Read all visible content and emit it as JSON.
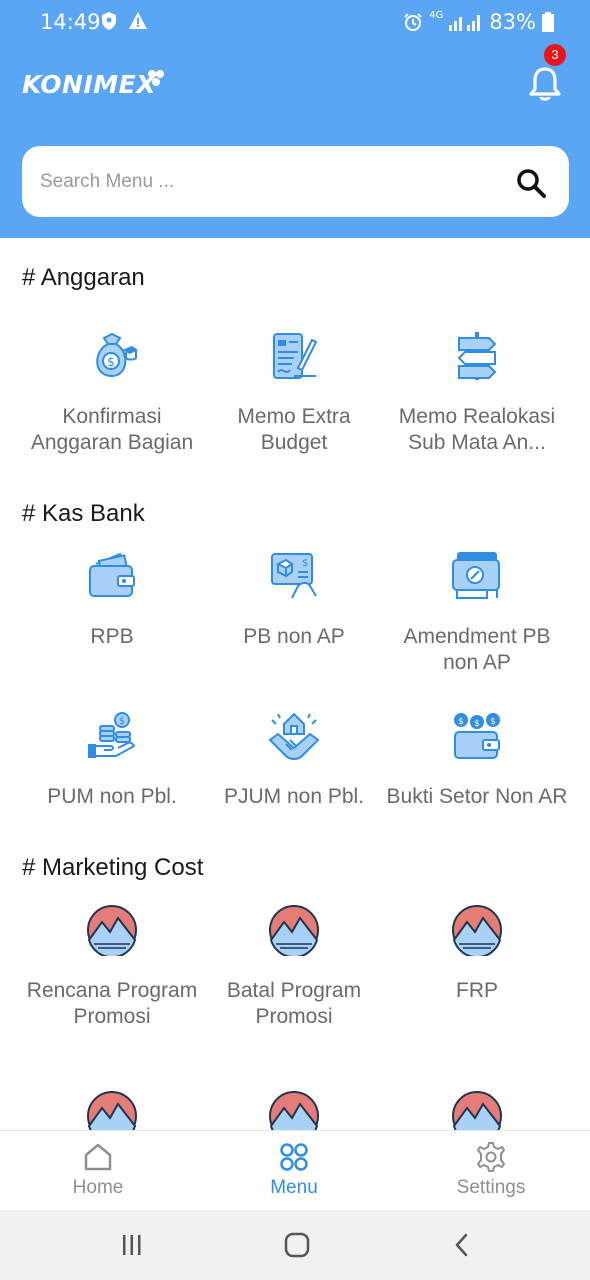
{
  "status": {
    "time": "14:49",
    "battery": "83%",
    "network": "4G"
  },
  "header": {
    "brand": "KONIMEX",
    "notification_count": "3",
    "search_placeholder": "Search Menu ..."
  },
  "sections": [
    {
      "title": "# Anggaran",
      "items": [
        {
          "label": "Konfirmasi Anggaran Bagian",
          "icon": "money-bag-icon"
        },
        {
          "label": "Memo Extra Budget",
          "icon": "memo-sign-icon"
        },
        {
          "label": "Memo Realokasi Sub Mata An...",
          "icon": "signpost-arrows-icon"
        }
      ]
    },
    {
      "title": "# Kas Bank",
      "items": [
        {
          "label": "RPB",
          "icon": "wallet-cash-icon"
        },
        {
          "label": "PB non AP",
          "icon": "invoice-hand-icon"
        },
        {
          "label": "Amendment PB non AP",
          "icon": "payment-card-icon"
        },
        {
          "label": "PUM non Pbl.",
          "icon": "coins-hand-icon"
        },
        {
          "label": "PJUM non Pbl.",
          "icon": "handshake-house-icon"
        },
        {
          "label": "Bukti Setor Non AR",
          "icon": "wallet-coins-icon"
        }
      ]
    },
    {
      "title": "# Marketing Cost",
      "items": [
        {
          "label": "Rencana Program Promosi",
          "icon": "mountain-icon"
        },
        {
          "label": "Batal Program Promosi",
          "icon": "mountain-icon"
        },
        {
          "label": "FRP",
          "icon": "mountain-icon"
        },
        {
          "label": "",
          "icon": "mountain-icon"
        },
        {
          "label": "",
          "icon": "mountain-icon"
        },
        {
          "label": "",
          "icon": "mountain-icon"
        }
      ]
    }
  ],
  "bottom_nav": {
    "items": [
      {
        "label": "Home",
        "icon": "home-icon",
        "active": false
      },
      {
        "label": "Menu",
        "icon": "grid-icon",
        "active": true
      },
      {
        "label": "Settings",
        "icon": "gear-icon",
        "active": false
      }
    ]
  },
  "colors": {
    "header": "#5aa6f5",
    "accent": "#2f8de4",
    "icon_light": "#a9d1f7",
    "badge": "#e8151b",
    "inactive": "#8f8f8f",
    "mountain_sky": "#e47c77"
  }
}
